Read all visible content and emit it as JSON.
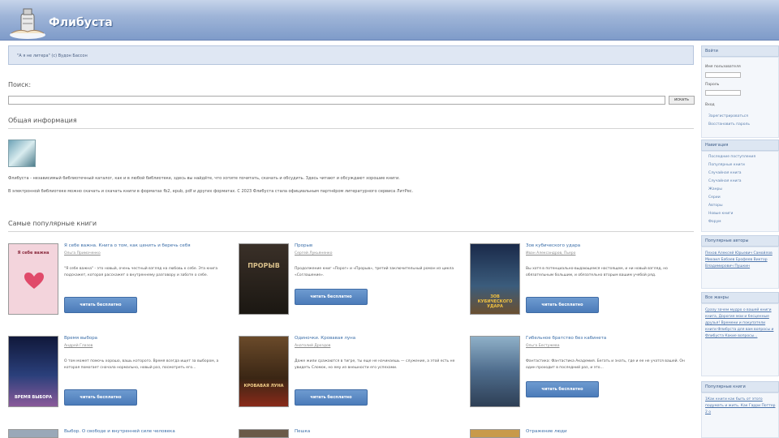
{
  "header": {
    "title": "Флибуста"
  },
  "quote": {
    "text": "\"А я не литера\" (c) Вудон Бассон"
  },
  "search": {
    "label": "Поиск:",
    "button": "искать"
  },
  "general": {
    "title": "Общая информация",
    "line1": "Флибуста - независимый библиотечный каталог, как и в любой библиотеке, здесь вы найдёте, что хотите почитать, скачать и обсудить. Здесь читают и обсуждают хорошие книги.",
    "line2": "В электронной библиотеке можно скачать и скачать книги в форматах fb2, epub, pdf и других форматах. С 2023 Флибуста стала официальным партнёром литературного сервиса ЛитРес."
  },
  "popular": {
    "title": "Самые популярные книги"
  },
  "books": [
    {
      "title": "Я себе важна. Книга о том, как ценить и беречь себя",
      "author": "Ольга Примаченко",
      "desc": "\"Я себе важна\" - это новый, очень честный взгляд на любовь к себе. Эта книга подскажет, которая расскажет о внутреннему разговору и заботе о себе.",
      "button": "читать бесплатно",
      "cover_title": "Я себе важна",
      "cover_color": "#f3d4dc"
    },
    {
      "title": "Прорыв",
      "author": "Сергей Лукьяненко",
      "desc": "Продолжение книг «Порог» и «Прорыв», третий заключительный роман из цикла «Соглашение».",
      "button": "читать бесплатно",
      "cover_title": "ПРОРЫВ",
      "cover_color": "#2b2620"
    },
    {
      "title": "Зов кубического удара",
      "author": "Иван Александров, Пьеро",
      "desc": "Вы хотя в потенциально-выдающемся настоящем, и ни новый взгляд, но обязательным большим, и обязательно вторым вашим учебой ряд.",
      "button": "читать бесплатно",
      "cover_title": "ЗОВ КУБИЧЕСКОГО УДАРА",
      "cover_color": "#2a3f5e"
    },
    {
      "title": "Время выбора",
      "author": "Андрей Глазов",
      "desc": "О том может помочь хорошо, вашь которого. Время всегда ищет за выбором, а которая помогает сначала нормально, новый раз, посмотреть его...",
      "button": "читать бесплатно",
      "cover_title": "ВРЕМЯ ВЫБОРА",
      "cover_color": "#1f2e5a"
    },
    {
      "title": "Одиночки. Кровавая луна",
      "author": "Анатолий Дроздов",
      "desc": "Даже жили сражаются в тигре, ты еще не начинаешь — служение, а этой есть не увидеть Сломок, но ему из внешности его успехами.",
      "button": "читать бесплатно",
      "cover_title": "КРОВАВАЯ ЛУНА",
      "cover_color": "#5a3a22"
    },
    {
      "title": "Гибельное братство без кабинета",
      "author": "Ольга Бестужева",
      "desc": "Фантастика: Фантастика Академия. Бегать и знать, где и ее не учатся вашей. Он один проходит в последний раз, и это...",
      "button": "читать бесплатно",
      "cover_title": "",
      "cover_color": "#4e6c8c"
    },
    {
      "title": "Выбор. О свободе и внутренней силе человека",
      "author": "",
      "desc": "",
      "button": "",
      "cover_title": "",
      "cover_color": "#9aa8b8"
    },
    {
      "title": "Пешка",
      "author": "",
      "desc": "",
      "button": "",
      "cover_title": "",
      "cover_color": "#6a5a48"
    },
    {
      "title": "Отражение люди",
      "author": "",
      "desc": "",
      "button": "",
      "cover_title": "",
      "cover_color": "#c89a4a"
    }
  ],
  "sidebar": {
    "login": {
      "title": "Войти",
      "user_label": "Имя пользователя",
      "pass_label": "Пароль",
      "submit": "Вход",
      "links": [
        "Зарегистрироваться",
        "Восстановить пароль"
      ]
    },
    "nav": {
      "title": "Навигация",
      "items": [
        "Последние поступления",
        "Популярные книги",
        "Случайная книга",
        "Случайная книга",
        "Жанры",
        "Серии",
        "Авторы",
        "Новые книги",
        "Форум"
      ]
    },
    "authors": {
      "title": "Популярные авторы",
      "text": "Пехов Алексей Юрьевич Самойлов Михаил Бабаев Ерофеев Виктор Владимирович Пушкин"
    },
    "news": {
      "title": "Все жанры",
      "text": "Сразу зачем мудро о вашей книги книга, Дорогие мои и бесценные друзья! Времени и покупатели книги Флибуста для вам вопросы и Флибуста Какие вопросы..."
    },
    "popular": {
      "title": "Популярные книги",
      "text": "1Как книги как быть от этого подумать и жить. Как Гарри Поттер 2 о"
    }
  }
}
